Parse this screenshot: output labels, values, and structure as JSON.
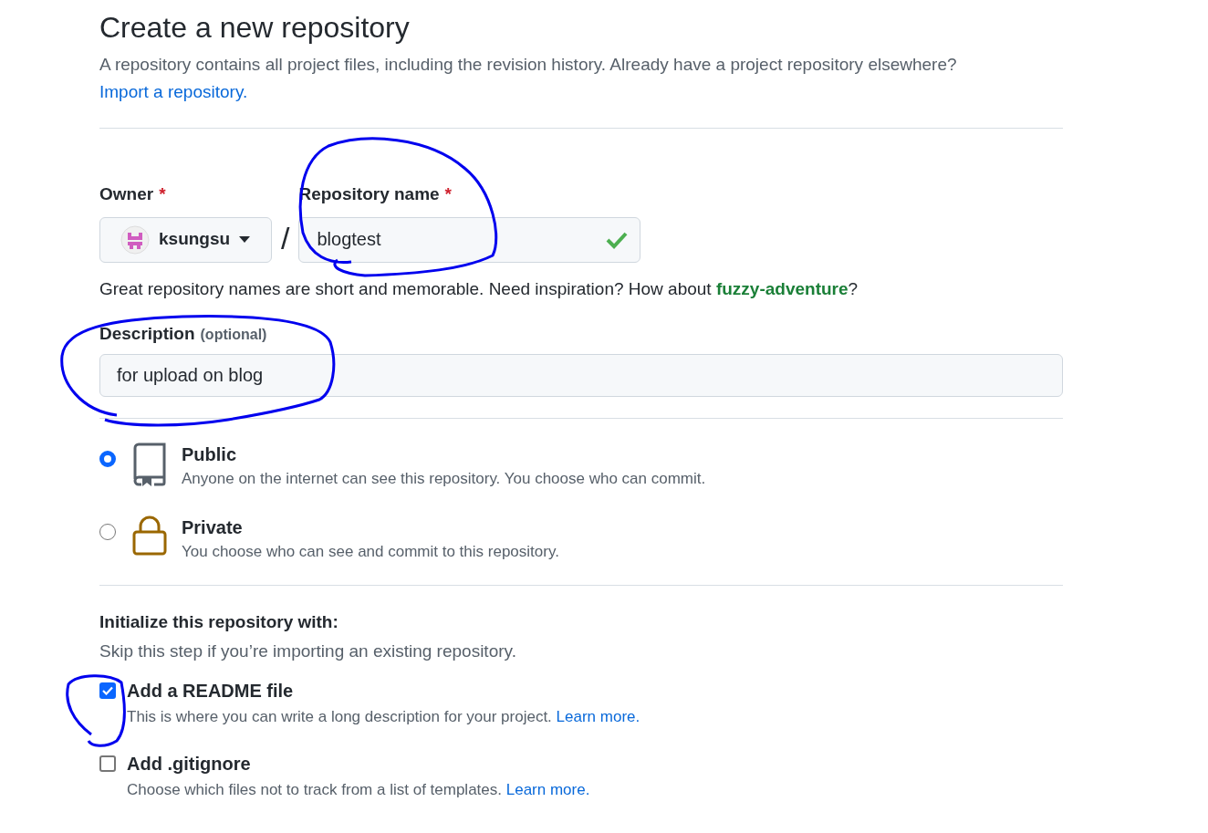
{
  "title": "Create a new repository",
  "intro": "A repository contains all project files, including the revision history. Already have a project repository elsewhere?",
  "import_link": "Import a repository.",
  "owner": {
    "label": "Owner",
    "required_mark": "*",
    "value": "ksungsu"
  },
  "separator": "/",
  "repo_name": {
    "label": "Repository name",
    "required_mark": "*",
    "value": "blogtest",
    "valid": true
  },
  "name_hint": {
    "text": "Great repository names are short and memorable. Need inspiration? How about",
    "suggestion": "fuzzy-adventure",
    "end": "?"
  },
  "description": {
    "label": "Description",
    "optional": "(optional)",
    "value": "for upload on blog"
  },
  "visibility": [
    {
      "kind": "public",
      "title": "Public",
      "text": "Anyone on the internet can see this repository. You choose who can commit.",
      "selected": true
    },
    {
      "kind": "private",
      "title": "Private",
      "text": "You choose who can see and commit to this repository.",
      "selected": false
    }
  ],
  "initialize": {
    "title": "Initialize this repository with:",
    "subtitle": "Skip this step if you’re importing an existing repository.",
    "options": [
      {
        "title": "Add a README file",
        "text": "This is where you can write a long description for your project.",
        "link": "Learn more.",
        "checked": true
      },
      {
        "title": "Add .gitignore",
        "text": "Choose which files not to track from a list of templates.",
        "link": "Learn more.",
        "checked": false
      }
    ]
  }
}
